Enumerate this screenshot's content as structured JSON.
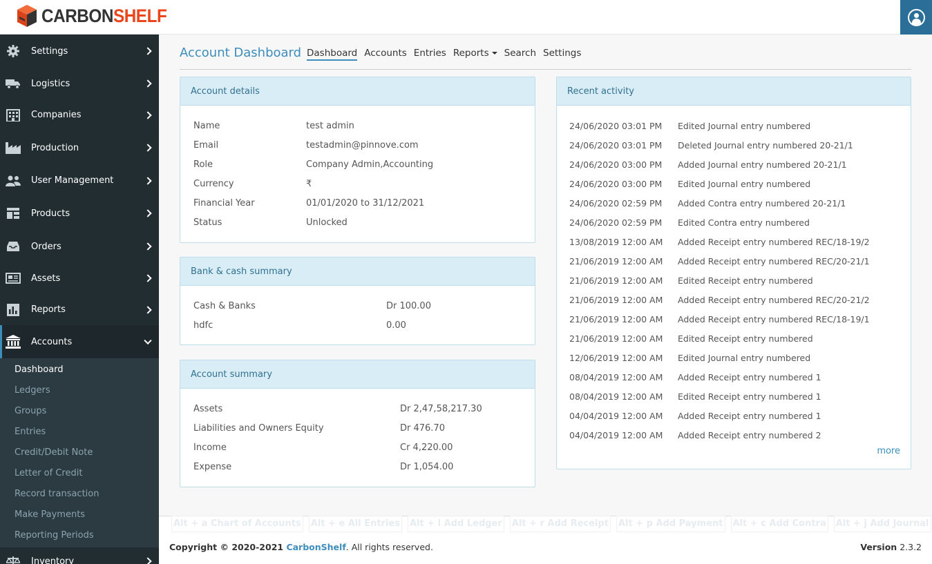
{
  "app": {
    "logo_part1": "CARBON",
    "logo_part2": "SHELF",
    "brand_color": "#e9461c",
    "accent_color": "#3c8dbc"
  },
  "sidebar": {
    "items": [
      {
        "label": "Settings",
        "icon": "gear-icon"
      },
      {
        "label": "Logistics",
        "icon": "truck-icon"
      },
      {
        "label": "Companies",
        "icon": "building-icon"
      },
      {
        "label": "Production",
        "icon": "factory-icon"
      },
      {
        "label": "User Management",
        "icon": "users-icon"
      },
      {
        "label": "Products",
        "icon": "grid-icon"
      },
      {
        "label": "Orders",
        "icon": "inbox-icon"
      },
      {
        "label": "Assets",
        "icon": "newspaper-icon"
      },
      {
        "label": "Reports",
        "icon": "bar-chart-icon"
      },
      {
        "label": "Accounts",
        "icon": "bank-icon"
      }
    ],
    "accounts_submenu": [
      "Dashboard",
      "Ledgers",
      "Groups",
      "Entries",
      "Credit/Debit Note",
      "Letter of Credit",
      "Record transaction",
      "Make Payments",
      "Reporting Periods"
    ],
    "inventory_label": "Inventory"
  },
  "header": {
    "title": "Account Dashboard",
    "tabs": [
      "Dashboard",
      "Accounts",
      "Entries",
      "Reports",
      "Search",
      "Settings"
    ]
  },
  "account_details": {
    "heading": "Account details",
    "rows": [
      {
        "label": "Name",
        "value": "test admin"
      },
      {
        "label": "Email",
        "value": "testadmin@pinnove.com"
      },
      {
        "label": "Role",
        "value": "Company Admin,Accounting"
      },
      {
        "label": "Currency",
        "value": "₹"
      },
      {
        "label": "Financial Year",
        "value": "01/01/2020 to 31/12/2021"
      },
      {
        "label": "Status",
        "value": "Unlocked"
      }
    ]
  },
  "bank_cash": {
    "heading": "Bank & cash summary",
    "rows": [
      {
        "label": "Cash & Banks",
        "value": "Dr 100.00"
      },
      {
        "label": "hdfc",
        "value": "0.00"
      }
    ]
  },
  "account_summary": {
    "heading": "Account summary",
    "rows": [
      {
        "label": "Assets",
        "value": "Dr 2,47,58,217.30"
      },
      {
        "label": "Liabilities and Owners Equity",
        "value": "Dr 476.70"
      },
      {
        "label": "Income",
        "value": "Cr 4,220.00"
      },
      {
        "label": "Expense",
        "value": "Dr 1,054.00"
      }
    ]
  },
  "recent_activity": {
    "heading": "Recent activity",
    "items": [
      {
        "date": "24/06/2020 03:01 PM",
        "text": "Edited Journal entry numbered"
      },
      {
        "date": "24/06/2020 03:01 PM",
        "text": "Deleted Journal entry numbered 20-21/1"
      },
      {
        "date": "24/06/2020 03:00 PM",
        "text": "Added Journal entry numbered 20-21/1"
      },
      {
        "date": "24/06/2020 03:00 PM",
        "text": "Edited Journal entry numbered"
      },
      {
        "date": "24/06/2020 02:59 PM",
        "text": "Added Contra entry numbered 20-21/1"
      },
      {
        "date": "24/06/2020 02:59 PM",
        "text": "Edited Contra entry numbered"
      },
      {
        "date": "13/08/2019 12:00 AM",
        "text": "Added Receipt entry numbered REC/18-19/2"
      },
      {
        "date": "21/06/2019 12:00 AM",
        "text": "Added Receipt entry numbered REC/20-21/1"
      },
      {
        "date": "21/06/2019 12:00 AM",
        "text": "Edited Receipt entry numbered"
      },
      {
        "date": "21/06/2019 12:00 AM",
        "text": "Added Receipt entry numbered REC/20-21/2"
      },
      {
        "date": "21/06/2019 12:00 AM",
        "text": "Added Receipt entry numbered REC/18-19/1"
      },
      {
        "date": "21/06/2019 12:00 AM",
        "text": "Edited Receipt entry numbered"
      },
      {
        "date": "12/06/2019 12:00 AM",
        "text": "Edited Journal entry numbered"
      },
      {
        "date": "08/04/2019 12:00 AM",
        "text": "Added Receipt entry numbered 1"
      },
      {
        "date": "08/04/2019 12:00 AM",
        "text": "Edited Receipt entry numbered 1"
      },
      {
        "date": "04/04/2019 12:00 AM",
        "text": "Added Receipt entry numbered 1"
      },
      {
        "date": "04/04/2019 12:00 AM",
        "text": "Added Receipt entry numbered 2"
      }
    ],
    "more_label": "more"
  },
  "shortcuts": [
    "Alt + a  Chart of Accounts",
    "Alt + e  All Entries",
    "Alt + l  Add Ledger",
    "Alt + r  Add Receipt",
    "Alt + p  Add Payment",
    "Alt + c  Add Contra",
    "Alt + j  Add Journal"
  ],
  "footer": {
    "copyright_prefix": "Copyright © 2020-2021 ",
    "brand": "CarbonShelf",
    "copyright_suffix": ". All rights reserved.",
    "version_label": "Version",
    "version": "2.3.2"
  }
}
